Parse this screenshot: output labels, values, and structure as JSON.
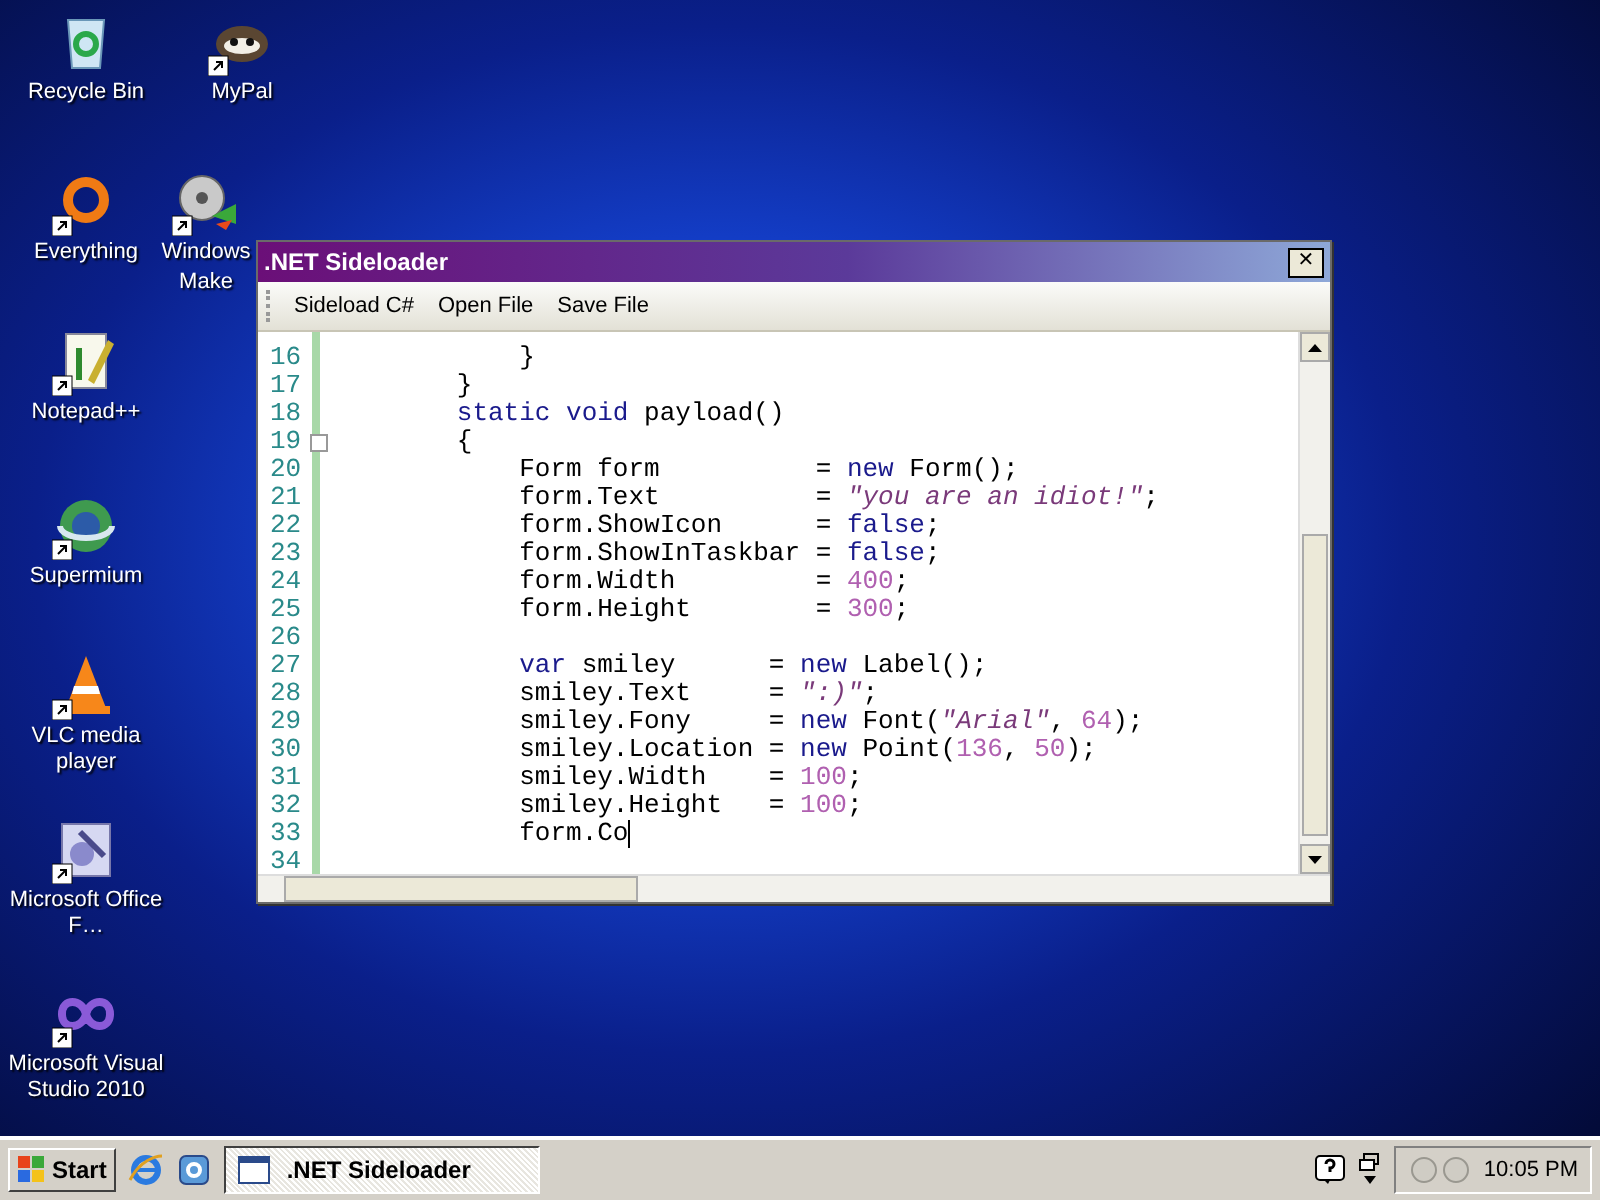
{
  "desktop_icons": [
    {
      "label": "Recycle Bin",
      "kind": "bin",
      "shortcut": false
    },
    {
      "label": "MyPal",
      "kind": "mascot",
      "shortcut": true
    },
    {
      "label": "Everything",
      "kind": "ring",
      "shortcut": true
    },
    {
      "label": "Windows",
      "label_tail": "Make",
      "kind": "film",
      "shortcut": true
    },
    {
      "label": "Notepad++",
      "kind": "notepad",
      "shortcut": true
    },
    {
      "label": "Supermium",
      "kind": "globe",
      "shortcut": true
    },
    {
      "label": "VLC media player",
      "kind": "cone",
      "shortcut": true
    },
    {
      "label": "Microsoft Office F…",
      "kind": "office",
      "shortcut": true
    },
    {
      "label": "Microsoft Visual Studio 2010",
      "kind": "infinity",
      "shortcut": true
    }
  ],
  "window": {
    "title": ".NET Sideloader",
    "close": "✕",
    "toolbar": [
      "Sideload C#",
      "Open File",
      "Save File"
    ],
    "editor": {
      "lines": [
        {
          "number": "16",
          "fold": false,
          "kind": "statement",
          "tokens": [
            {
              "kind": "plain",
              "text": "}"
            }
          ]
        },
        {
          "number": "17",
          "fold": false,
          "kind": "member",
          "tokens": [
            {
              "kind": "plain",
              "text": "}"
            }
          ]
        },
        {
          "number": "18",
          "fold": false,
          "kind": "member",
          "tokens": [
            {
              "kind": "keyword",
              "text": "static void"
            },
            {
              "kind": "plain",
              "text": " payload()"
            }
          ]
        },
        {
          "number": "19",
          "fold": true,
          "kind": "member",
          "tokens": [
            {
              "kind": "plain",
              "text": "{"
            }
          ]
        },
        {
          "number": "20",
          "fold": false,
          "kind": "statement",
          "tokens": [
            {
              "kind": "plain",
              "text": "Form form          = "
            },
            {
              "kind": "keyword",
              "text": "new"
            },
            {
              "kind": "plain",
              "text": " Form();"
            }
          ]
        },
        {
          "number": "21",
          "fold": false,
          "kind": "statement",
          "tokens": [
            {
              "kind": "plain",
              "text": "form.Text          = "
            },
            {
              "kind": "string",
              "text": "\"you are an idiot!\""
            },
            {
              "kind": "plain",
              "text": ";"
            }
          ]
        },
        {
          "number": "22",
          "fold": false,
          "kind": "statement",
          "tokens": [
            {
              "kind": "plain",
              "text": "form.ShowIcon      = "
            },
            {
              "kind": "keyword",
              "text": "false"
            },
            {
              "kind": "plain",
              "text": ";"
            }
          ]
        },
        {
          "number": "23",
          "fold": false,
          "kind": "statement",
          "tokens": [
            {
              "kind": "plain",
              "text": "form.ShowInTaskbar = "
            },
            {
              "kind": "keyword",
              "text": "false"
            },
            {
              "kind": "plain",
              "text": ";"
            }
          ]
        },
        {
          "number": "24",
          "fold": false,
          "kind": "statement",
          "tokens": [
            {
              "kind": "plain",
              "text": "form.Width         = "
            },
            {
              "kind": "number",
              "text": "400"
            },
            {
              "kind": "plain",
              "text": ";"
            }
          ]
        },
        {
          "number": "25",
          "fold": false,
          "kind": "statement",
          "tokens": [
            {
              "kind": "plain",
              "text": "form.Height        = "
            },
            {
              "kind": "number",
              "text": "300"
            },
            {
              "kind": "plain",
              "text": ";"
            }
          ]
        },
        {
          "number": "26",
          "fold": false,
          "kind": "statement"
        },
        {
          "number": "27",
          "fold": false,
          "kind": "statement",
          "tokens": [
            {
              "kind": "keyword",
              "text": "var"
            },
            {
              "kind": "plain",
              "text": " smiley      = "
            },
            {
              "kind": "keyword",
              "text": "new"
            },
            {
              "kind": "plain",
              "text": " Label();"
            }
          ]
        },
        {
          "number": "28",
          "fold": false,
          "kind": "statement",
          "tokens": [
            {
              "kind": "plain",
              "text": "smiley.Text     = "
            },
            {
              "kind": "string",
              "text": "\":)\""
            },
            {
              "kind": "plain",
              "text": ";"
            }
          ]
        },
        {
          "number": "29",
          "fold": false,
          "kind": "statement",
          "tokens": [
            {
              "kind": "plain",
              "text": "smiley.Fony     = "
            },
            {
              "kind": "keyword",
              "text": "new"
            },
            {
              "kind": "plain",
              "text": " Font("
            },
            {
              "kind": "string",
              "text": "\"Arial\""
            },
            {
              "kind": "plain",
              "text": ", "
            },
            {
              "kind": "number",
              "text": "64"
            },
            {
              "kind": "plain",
              "text": ");"
            }
          ]
        },
        {
          "number": "30",
          "fold": false,
          "kind": "statement",
          "tokens": [
            {
              "kind": "plain",
              "text": "smiley.Location = "
            },
            {
              "kind": "keyword",
              "text": "new"
            },
            {
              "kind": "plain",
              "text": " Point("
            },
            {
              "kind": "number",
              "text": "136"
            },
            {
              "kind": "plain",
              "text": ", "
            },
            {
              "kind": "number",
              "text": "50"
            },
            {
              "kind": "plain",
              "text": ");"
            }
          ]
        },
        {
          "number": "31",
          "fold": false,
          "kind": "statement",
          "tokens": [
            {
              "kind": "plain",
              "text": "smiley.Width    = "
            },
            {
              "kind": "number",
              "text": "100"
            },
            {
              "kind": "plain",
              "text": ";"
            }
          ]
        },
        {
          "number": "32",
          "fold": false,
          "kind": "statement",
          "tokens": [
            {
              "kind": "plain",
              "text": "smiley.Height   = "
            },
            {
              "kind": "number",
              "text": "100"
            },
            {
              "kind": "plain",
              "text": ";"
            }
          ]
        },
        {
          "number": "33",
          "fold": false,
          "kind": "statement",
          "tokens": [
            {
              "kind": "plain",
              "text": "form.Co"
            }
          ],
          "caret": true
        },
        {
          "number": "34",
          "fold": false,
          "kind": "statement"
        }
      ]
    }
  },
  "taskbar": {
    "start": "Start",
    "tasks": [
      {
        "label": ".NET Sideloader",
        "selected": true
      }
    ],
    "clock": "10:05 PM"
  }
}
